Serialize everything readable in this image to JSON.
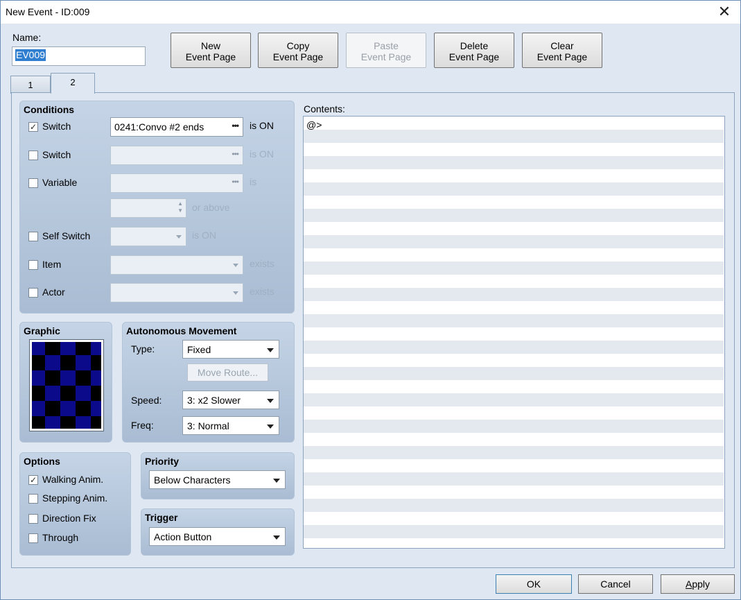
{
  "window": {
    "title": "New Event - ID:009",
    "close_glyph": "✕"
  },
  "name": {
    "label": "Name:",
    "value": "EV009"
  },
  "toolbar": {
    "new_line1": "New",
    "new_line2": "Event Page",
    "copy_line1": "Copy",
    "copy_line2": "Event Page",
    "paste_line1": "Paste",
    "paste_line2": "Event Page",
    "delete_line1": "Delete",
    "delete_line2": "Event Page",
    "clear_line1": "Clear",
    "clear_line2": "Event Page"
  },
  "tabs": [
    {
      "label": "1"
    },
    {
      "label": "2"
    }
  ],
  "conditions": {
    "title": "Conditions",
    "switch1": {
      "label": "Switch",
      "checked": "✓",
      "value": "0241:Convo #2 ends",
      "suffix": "is ON"
    },
    "switch2": {
      "label": "Switch",
      "suffix": "is ON"
    },
    "variable": {
      "label": "Variable",
      "suffix": "is",
      "suffix2": "or above"
    },
    "self_switch": {
      "label": "Self Switch",
      "suffix": "is ON"
    },
    "item": {
      "label": "Item",
      "suffix": "exists"
    },
    "actor": {
      "label": "Actor",
      "suffix": "exists"
    },
    "ellipsis": "•••"
  },
  "graphic": {
    "title": "Graphic"
  },
  "movement": {
    "title": "Autonomous Movement",
    "type_label": "Type:",
    "type_value": "Fixed",
    "move_route": "Move Route...",
    "speed_label": "Speed:",
    "speed_value": "3: x2 Slower",
    "freq_label": "Freq:",
    "freq_value": "3: Normal"
  },
  "options": {
    "title": "Options",
    "walking": {
      "label": "Walking Anim.",
      "checked": "✓"
    },
    "stepping": {
      "label": "Stepping Anim."
    },
    "direction": {
      "label": "Direction Fix"
    },
    "through": {
      "label": "Through"
    }
  },
  "priority": {
    "title": "Priority",
    "value": "Below Characters"
  },
  "trigger": {
    "title": "Trigger",
    "value": "Action Button"
  },
  "contents": {
    "label": "Contents:",
    "first_line": "@>"
  },
  "footer": {
    "ok": "OK",
    "cancel": "Cancel",
    "apply_first": "A",
    "apply_rest": "pply"
  },
  "colors": {
    "accent": "#2f7ed0",
    "window_bg": "#dfe8f2",
    "panel_bg": "#b6c7db"
  }
}
